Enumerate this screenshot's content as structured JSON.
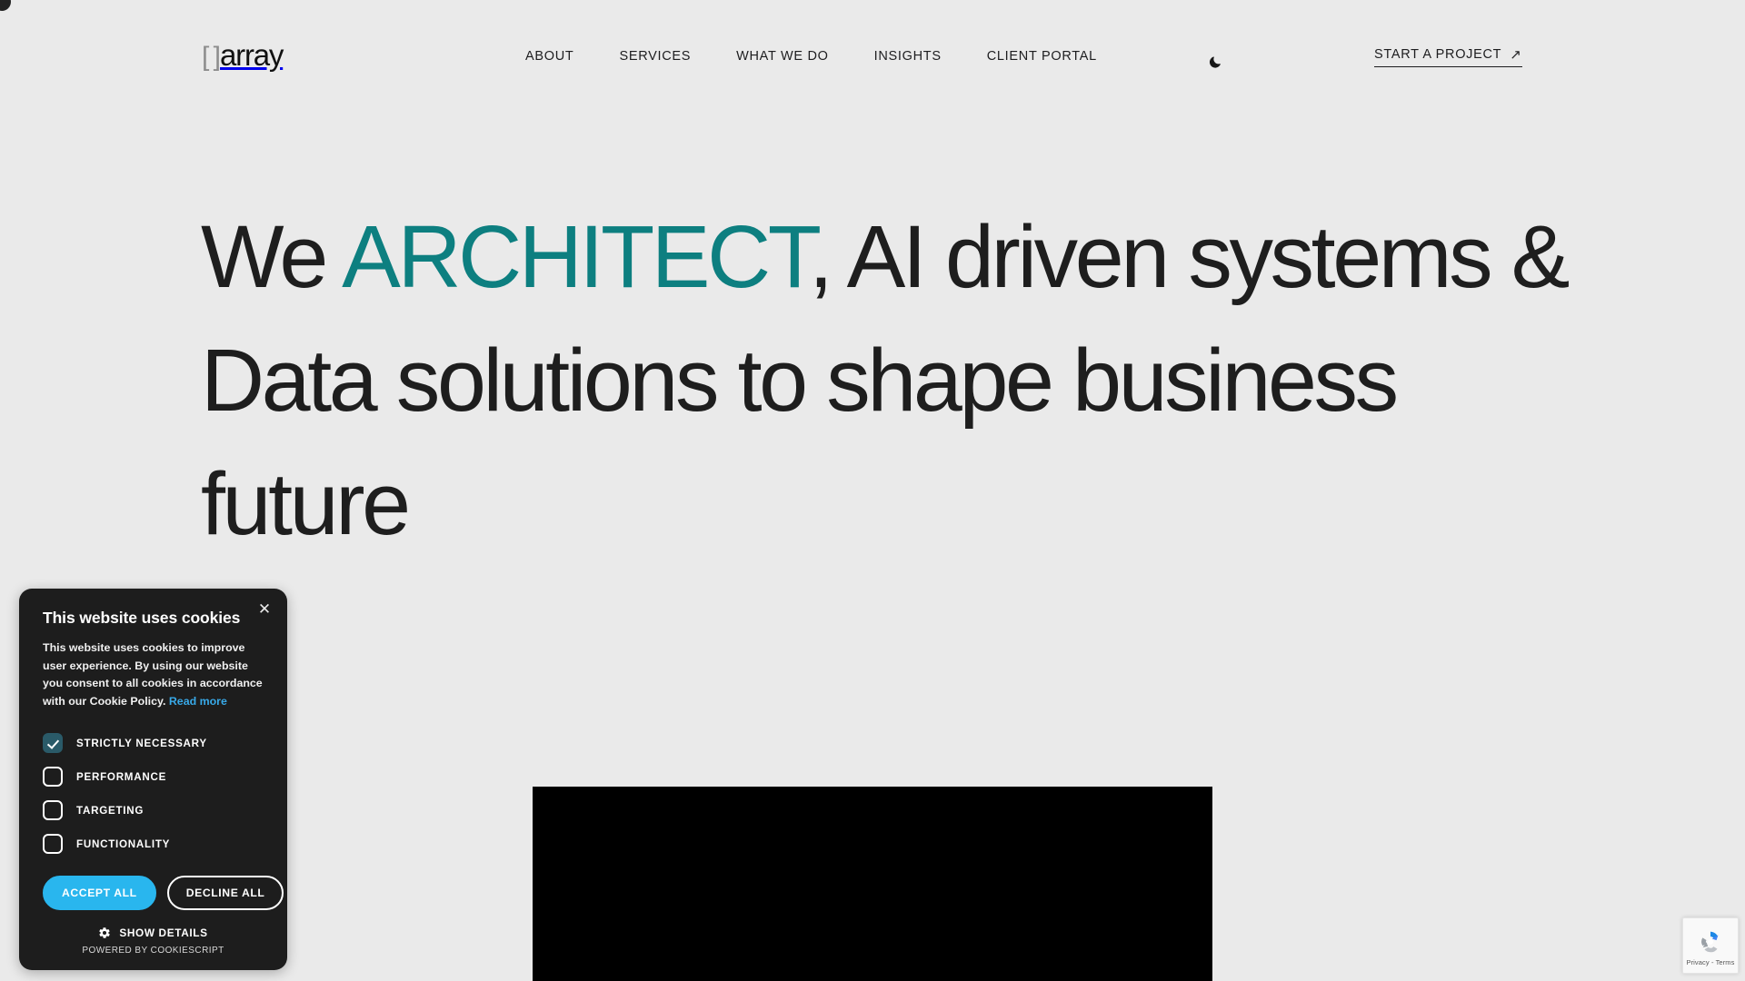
{
  "page": {
    "background_color": "#eaeaea",
    "text_color": "#1e1e1e",
    "accent_color": "#0d7f80"
  },
  "header": {
    "logo": {
      "brackets": "[ ]",
      "word": "array"
    },
    "nav": [
      {
        "label": "ABOUT",
        "name": "about"
      },
      {
        "label": "SERVICES",
        "name": "services"
      },
      {
        "label": "WHAT WE DO",
        "name": "what-we-do"
      },
      {
        "label": "INSIGHTS",
        "name": "insights"
      },
      {
        "label": "CLIENT PORTAL",
        "name": "client-portal"
      }
    ],
    "theme_toggle": {
      "icon": "moon-icon",
      "state": "light"
    },
    "cta": {
      "label": "START A PROJECT",
      "arrow": "↗"
    }
  },
  "hero": {
    "headline": {
      "part1": "We ",
      "accent": "ARCHITECT",
      "part2": ", AI driven systems & Data solutions to shape business future"
    },
    "media": {
      "name": "hero-video-block",
      "color": "#000000"
    }
  },
  "cookie_banner": {
    "title": "This website uses cookies",
    "body": "This website uses cookies to improve user experience. By using our website you consent to all cookies in accordance with our Cookie Policy.",
    "read_more": "Read more",
    "close_icon": "✕",
    "options": [
      {
        "label": "STRICTLY NECESSARY",
        "checked": true,
        "name": "strictly-necessary"
      },
      {
        "label": "PERFORMANCE",
        "checked": false,
        "name": "performance"
      },
      {
        "label": "TARGETING",
        "checked": false,
        "name": "targeting"
      },
      {
        "label": "FUNCTIONALITY",
        "checked": false,
        "name": "functionality"
      }
    ],
    "accept_label": "ACCEPT ALL",
    "decline_label": "DECLINE ALL",
    "details_label": "SHOW DETAILS",
    "details_icon": "gear-icon",
    "powered_by": "POWERED BY COOKIESCRIPT",
    "accept_color": "#29b6ee",
    "link_color": "#38a9e8",
    "checked_color": "#2a5a68"
  },
  "recaptcha": {
    "text": "Privacy - Terms",
    "icon": "recaptcha-icon"
  }
}
